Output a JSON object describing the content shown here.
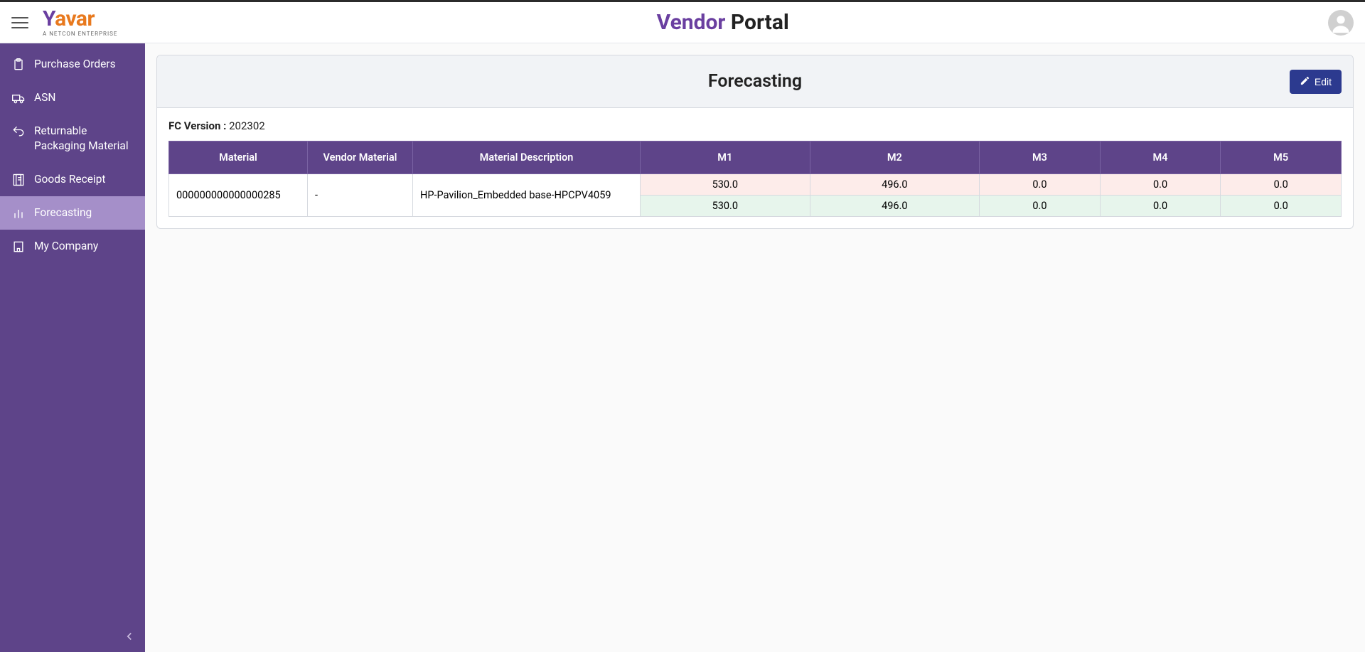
{
  "header": {
    "logo_main_1": "Y",
    "logo_main_2": "avar",
    "logo_sub": "A NETCON ENTERPRISE",
    "title_1": "Vendor",
    "title_2": "Portal"
  },
  "sidebar": {
    "items": [
      {
        "label": "Purchase Orders",
        "icon": "clipboard-icon",
        "active": false
      },
      {
        "label": "ASN",
        "icon": "truck-icon",
        "active": false
      },
      {
        "label": "Returnable Packaging Material",
        "icon": "return-icon",
        "active": false
      },
      {
        "label": "Goods Receipt",
        "icon": "receipt-icon",
        "active": false
      },
      {
        "label": "Forecasting",
        "icon": "chart-icon",
        "active": true
      },
      {
        "label": "My Company",
        "icon": "building-icon",
        "active": false
      }
    ]
  },
  "page": {
    "title": "Forecasting",
    "edit_label": "Edit",
    "fc_label": "FC Version :",
    "fc_value": "202302",
    "columns": [
      "Material",
      "Vendor Material",
      "Material Description",
      "M1",
      "M2",
      "M3",
      "M4",
      "M5"
    ],
    "rows": [
      {
        "material": "000000000000000285",
        "vendor_material": "-",
        "description": "HP-Pavilion_Embedded base-HPCPV4059",
        "months": [
          {
            "top": "530.0",
            "bot": "530.0"
          },
          {
            "top": "496.0",
            "bot": "496.0"
          },
          {
            "top": "0.0",
            "bot": "0.0"
          },
          {
            "top": "0.0",
            "bot": "0.0"
          },
          {
            "top": "0.0",
            "bot": "0.0"
          }
        ]
      }
    ]
  },
  "colors": {
    "brand_purple": "#5e4489",
    "brand_orange": "#e8791e",
    "accent_blue": "#2c3a8f",
    "row_red": "#fdecea",
    "row_green": "#e7f5ec",
    "sidebar_active": "#a58fc9"
  }
}
